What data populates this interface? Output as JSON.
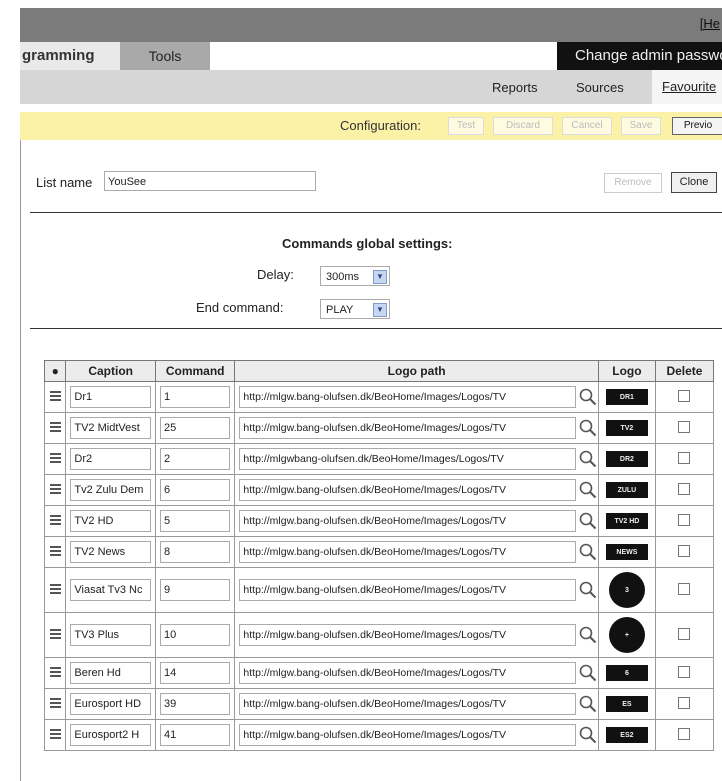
{
  "header": {
    "help_link": "[He",
    "tab_programming": "gramming",
    "tab_tools": "Tools",
    "admin_button": "Change admin passwor"
  },
  "subnav": {
    "reports": "Reports",
    "sources": "Sources",
    "favourites": "Favourite"
  },
  "config": {
    "label": "Configuration:",
    "test": "Test",
    "discard": "Discard",
    "cancel": "Cancel",
    "save": "Save",
    "preview": "Previo"
  },
  "list": {
    "label": "List name",
    "value": "YouSee",
    "remove": "Remove",
    "clone": "Clone"
  },
  "global": {
    "title": "Commands global settings:",
    "delay_label": "Delay:",
    "delay_value": "300ms",
    "end_label": "End command:",
    "end_value": "PLAY"
  },
  "table": {
    "headers": {
      "handle": "●",
      "caption": "Caption",
      "command": "Command",
      "logo_path": "Logo path",
      "logo": "Logo",
      "delete": "Delete"
    },
    "rows": [
      {
        "caption": "Dr1",
        "command": "1",
        "path": "http://mlgw.bang-olufsen.dk/BeoHome/Images/Logos/TV",
        "logo": "DR1",
        "tall": false
      },
      {
        "caption": "TV2 MidtVest",
        "command": "25",
        "path": "http://mlgw.bang-olufsen.dk/BeoHome/Images/Logos/TV",
        "logo": "TV2",
        "tall": false
      },
      {
        "caption": "Dr2",
        "command": "2",
        "path": "http://mlgwbang-olufsen.dk/BeoHome/Images/Logos/TV",
        "logo": "DR2",
        "tall": false
      },
      {
        "caption": "Tv2 Zulu Dem",
        "command": "6",
        "path": "http://mlgw.bang-olufsen.dk/BeoHome/Images/Logos/TV",
        "logo": "ZULU",
        "tall": false
      },
      {
        "caption": "TV2 HD",
        "command": "5",
        "path": "http://mlgw.bang-olufsen.dk/BeoHome/Images/Logos/TV",
        "logo": "TV2 HD",
        "tall": false
      },
      {
        "caption": "TV2 News",
        "command": "8",
        "path": "http://mlgw.bang-olufsen.dk/BeoHome/Images/Logos/TV",
        "logo": "NEWS",
        "tall": false
      },
      {
        "caption": "Viasat Tv3 Nc",
        "command": "9",
        "path": "http://mlgw.bang-olufsen.dk/BeoHome/Images/Logos/TV",
        "logo": "3",
        "tall": true
      },
      {
        "caption": "TV3 Plus",
        "command": "10",
        "path": "http://mlgw.bang-olufsen.dk/BeoHome/Images/Logos/TV",
        "logo": "+",
        "tall": true
      },
      {
        "caption": "Beren Hd",
        "command": "14",
        "path": "http://mlgw.bang-olufsen.dk/BeoHome/Images/Logos/TV",
        "logo": "6",
        "tall": false
      },
      {
        "caption": "Eurosport HD",
        "command": "39",
        "path": "http://mlgw.bang-olufsen.dk/BeoHome/Images/Logos/TV",
        "logo": "ES",
        "tall": false
      },
      {
        "caption": "Eurosport2 H",
        "command": "41",
        "path": "http://mlgw.bang-olufsen.dk/BeoHome/Images/Logos/TV",
        "logo": "ES2",
        "tall": false
      }
    ]
  }
}
